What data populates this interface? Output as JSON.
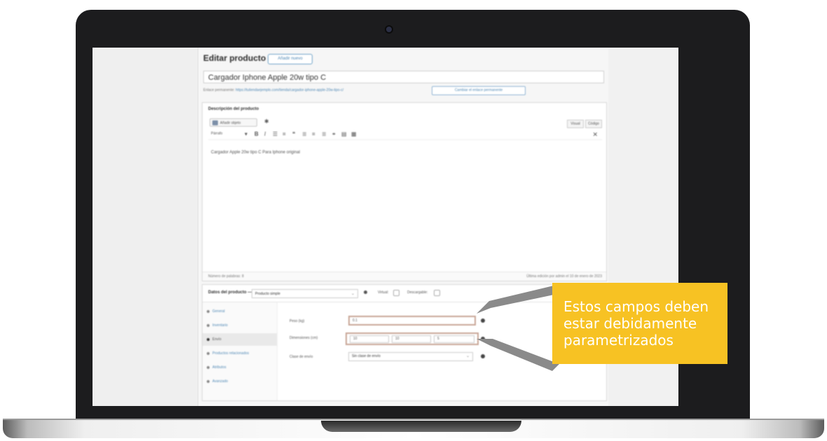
{
  "editor": {
    "page_title": "Editar producto",
    "add_new_label": "Añadir nuevo",
    "product_title": "Cargador Iphone Apple 20w tipo C",
    "permalink_label": "Enlace permanente:",
    "permalink_url": "https://tutiendaejemplo.com/tienda/cargador-iphone-apple-20w-tipo-c/",
    "permalink_button": "Cambiar el enlace permanente",
    "description_title": "Descripción del producto",
    "add_media_label": "Añadir objeto",
    "tab_visual": "Visual",
    "tab_text": "Código",
    "format_label": "Párrafo",
    "description_text": "Cargador Apple 20w tipo C Para Iphone original",
    "word_count": "Número de palabras: 8",
    "last_edited": "Última edición por admin el 10 de enero de 2023"
  },
  "product_data": {
    "title": "Datos del producto —",
    "type_value": "Producto simple",
    "virtual_label": "Virtual:",
    "downloadable_label": "Descargable:",
    "tabs": [
      {
        "label": "General"
      },
      {
        "label": "Inventario"
      },
      {
        "label": "Envío"
      },
      {
        "label": "Productos relacionados"
      },
      {
        "label": "Atributos"
      },
      {
        "label": "Avanzado"
      }
    ],
    "weight_label": "Peso (kg)",
    "weight_value": "0.1",
    "dimensions_label": "Dimensiones (cm)",
    "length_value": "10",
    "width_value": "10",
    "height_value": "5",
    "shipping_class_label": "Clase de envío",
    "shipping_class_value": "Sin clase de envío"
  },
  "callout": {
    "line1": "Estos campos deben",
    "line2": "estar debidamente",
    "line3": "parametrizados",
    "color": "#f7c223"
  }
}
